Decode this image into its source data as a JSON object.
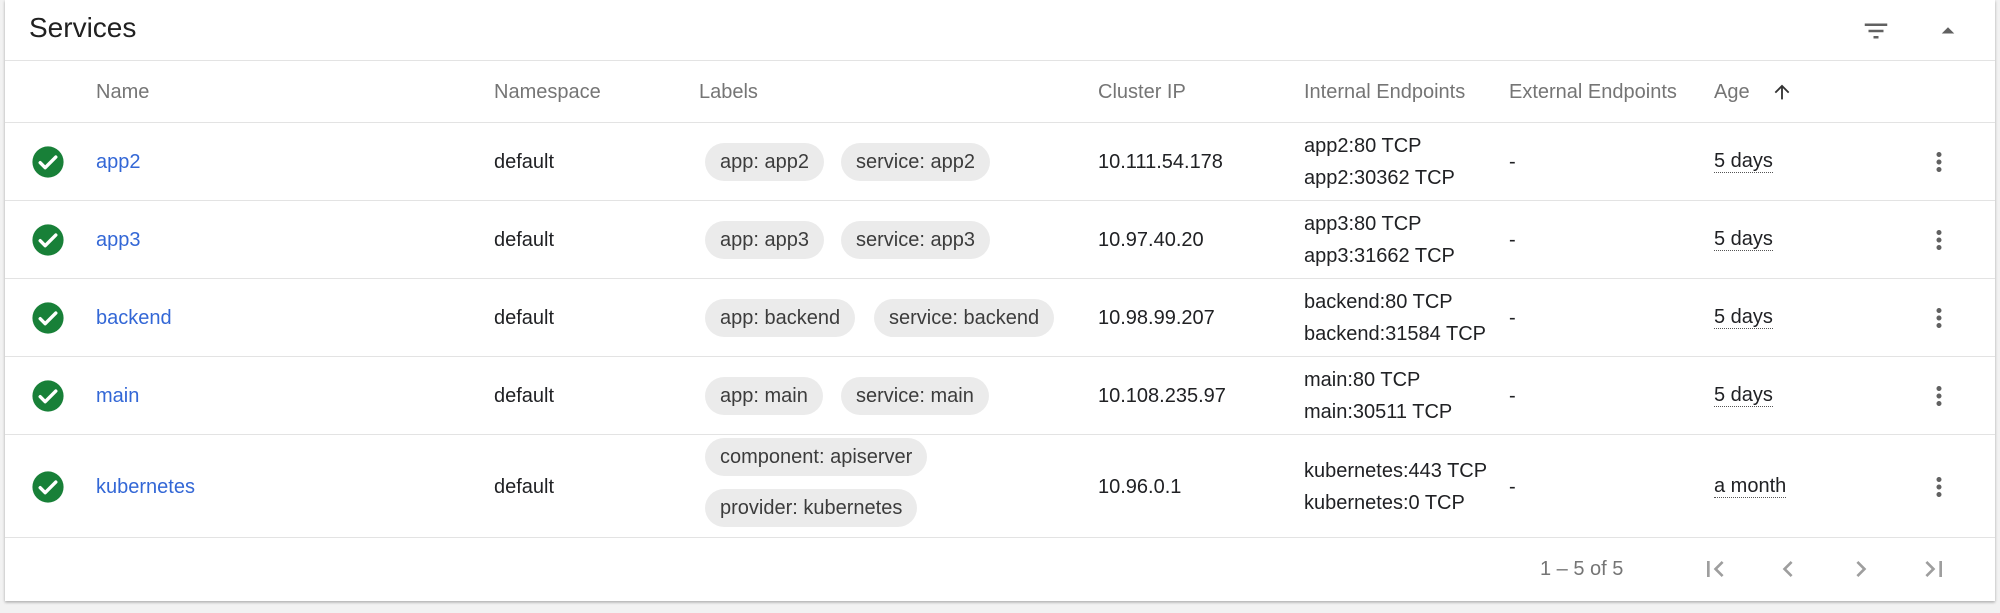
{
  "header": {
    "title": "Services",
    "filter_icon": "filter-list-icon",
    "collapse_icon": "arrow-drop-up-icon"
  },
  "columns": {
    "name": "Name",
    "namespace": "Namespace",
    "labels": "Labels",
    "cluster_ip": "Cluster IP",
    "internal_endpoints": "Internal Endpoints",
    "external_endpoints": "External Endpoints",
    "age": "Age",
    "age_sort": "ascending"
  },
  "rows": [
    {
      "status": "check-circle-icon",
      "name": "app2",
      "namespace": "default",
      "labels": [
        "app: app2",
        "service: app2"
      ],
      "cluster_ip": "10.111.54.178",
      "internal_endpoints": [
        "app2:80 TCP",
        "app2:30362 TCP"
      ],
      "external_endpoints": "-",
      "age": "5 days"
    },
    {
      "status": "check-circle-icon",
      "name": "app3",
      "namespace": "default",
      "labels": [
        "app: app3",
        "service: app3"
      ],
      "cluster_ip": "10.97.40.20",
      "internal_endpoints": [
        "app3:80 TCP",
        "app3:31662 TCP"
      ],
      "external_endpoints": "-",
      "age": "5 days"
    },
    {
      "status": "check-circle-icon",
      "name": "backend",
      "namespace": "default",
      "labels": [
        "app: backend",
        "service: backend"
      ],
      "cluster_ip": "10.98.99.207",
      "internal_endpoints": [
        "backend:80 TCP",
        "backend:31584 TCP"
      ],
      "external_endpoints": "-",
      "age": "5 days"
    },
    {
      "status": "check-circle-icon",
      "name": "main",
      "namespace": "default",
      "labels": [
        "app: main",
        "service: main"
      ],
      "cluster_ip": "10.108.235.97",
      "internal_endpoints": [
        "main:80 TCP",
        "main:30511 TCP"
      ],
      "external_endpoints": "-",
      "age": "5 days"
    },
    {
      "status": "check-circle-icon",
      "name": "kubernetes",
      "namespace": "default",
      "labels": [
        "component: apiserver",
        "provider: kubernetes"
      ],
      "cluster_ip": "10.96.0.1",
      "internal_endpoints": [
        "kubernetes:443 TCP",
        "kubernetes:0 TCP"
      ],
      "external_endpoints": "-",
      "age": "a month"
    }
  ],
  "paginator": {
    "range_label": "1 – 5 of 5",
    "first_icon": "first-page-icon",
    "prev_icon": "chevron-left-icon",
    "next_icon": "chevron-right-icon",
    "last_icon": "last-page-icon"
  },
  "colors": {
    "link": "#3367d6",
    "status_ok": "#188038",
    "chip_bg": "#ebebeb",
    "muted_text": "#757575"
  }
}
